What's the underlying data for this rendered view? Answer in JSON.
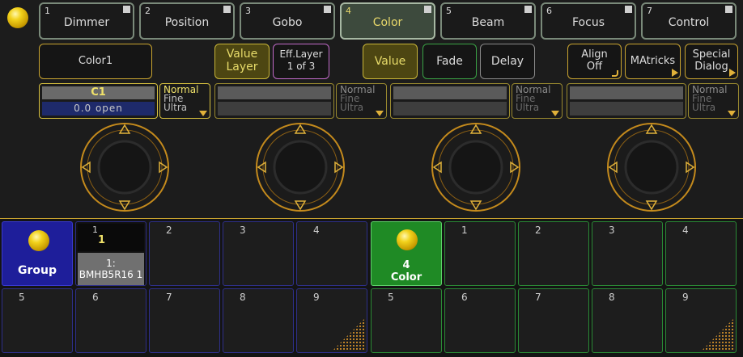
{
  "feature_tabs": [
    {
      "num": "1",
      "label": "Dimmer"
    },
    {
      "num": "2",
      "label": "Position"
    },
    {
      "num": "3",
      "label": "Gobo"
    },
    {
      "num": "4",
      "label": "Color"
    },
    {
      "num": "5",
      "label": "Beam"
    },
    {
      "num": "6",
      "label": "Focus"
    },
    {
      "num": "7",
      "label": "Control"
    }
  ],
  "controls": {
    "attribute": "Color1",
    "value_layer": [
      "Value",
      "Layer"
    ],
    "eff_layer": [
      "Eff.Layer",
      "1 of 3"
    ],
    "value": "Value",
    "fade": "Fade",
    "delay": "Delay",
    "align": [
      "Align",
      "Off"
    ],
    "matricks": "MAtricks",
    "special_dialog": [
      "Special",
      "Dialog"
    ]
  },
  "encoder_value": {
    "name": "C1",
    "value": "0.0 open"
  },
  "resolution": {
    "normal": "Normal",
    "fine": "Fine",
    "ultra": "Ultra"
  },
  "pool_left": {
    "group_label": "Group",
    "selected": {
      "num": "1",
      "label": "1",
      "sub1": "1:",
      "sub2": "BMHB5R16 1"
    },
    "row1_nums": [
      "2",
      "3",
      "4"
    ],
    "row2_nums": [
      "5",
      "6",
      "7",
      "8",
      "9"
    ]
  },
  "pool_right": {
    "active": {
      "num": "4",
      "label": "Color"
    },
    "row1_nums": [
      "1",
      "2",
      "3",
      "4"
    ],
    "row2_nums": [
      "5",
      "6",
      "7",
      "8",
      "9"
    ]
  },
  "colors": {
    "accent": "#c9a430",
    "active_green": "#1f8a25",
    "group_blue": "#1e1e9a"
  }
}
